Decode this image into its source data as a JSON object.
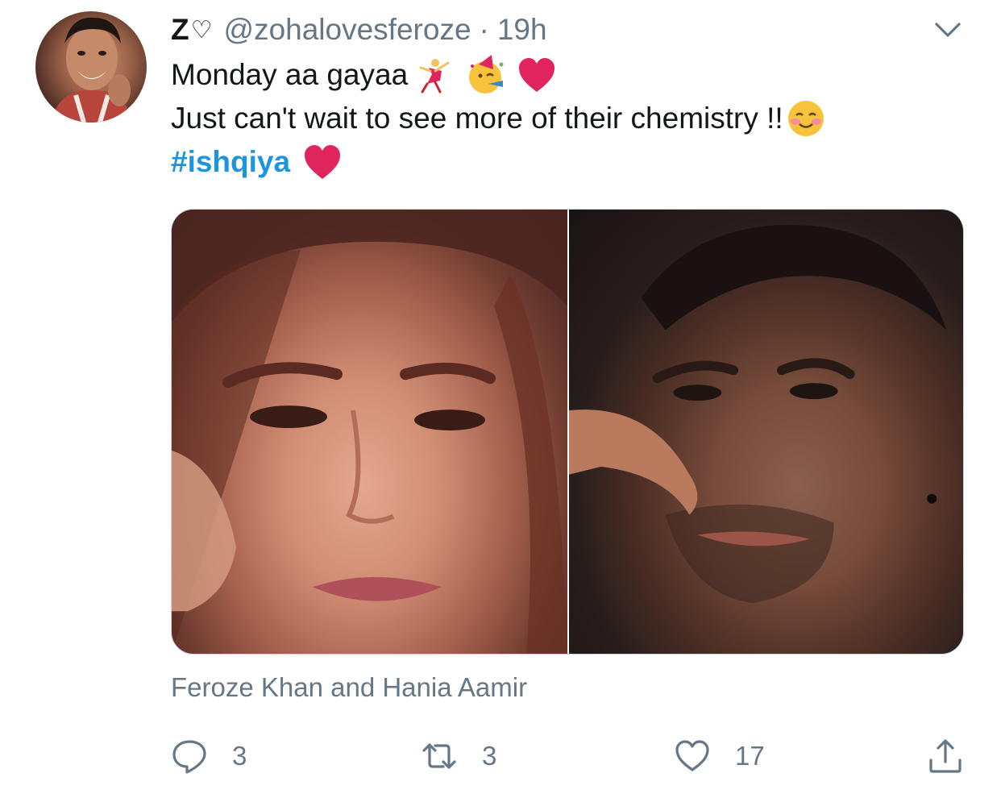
{
  "tweet": {
    "display_name": "Z",
    "display_heart": "♡",
    "handle": "@zohalovesferoze",
    "separator": "·",
    "time": "19h",
    "line1": "Monday aa gayaa",
    "line2": "Just can't wait to see more of their chemistry !!",
    "hashtag": "#ishqiya",
    "caption": "Feroze Khan and Hania Aamir"
  },
  "actions": {
    "reply_count": "3",
    "retweet_count": "3",
    "like_count": "17"
  },
  "icons": {
    "avatar": "avatar-photo",
    "menu": "chevron-down-icon",
    "reply": "reply-icon",
    "retweet": "retweet-icon",
    "like": "heart-icon",
    "share": "share-icon"
  },
  "colors": {
    "text": "#14171a",
    "secondary": "#657786",
    "link": "#1b95e0",
    "heart_emoji": "#e0245e"
  }
}
